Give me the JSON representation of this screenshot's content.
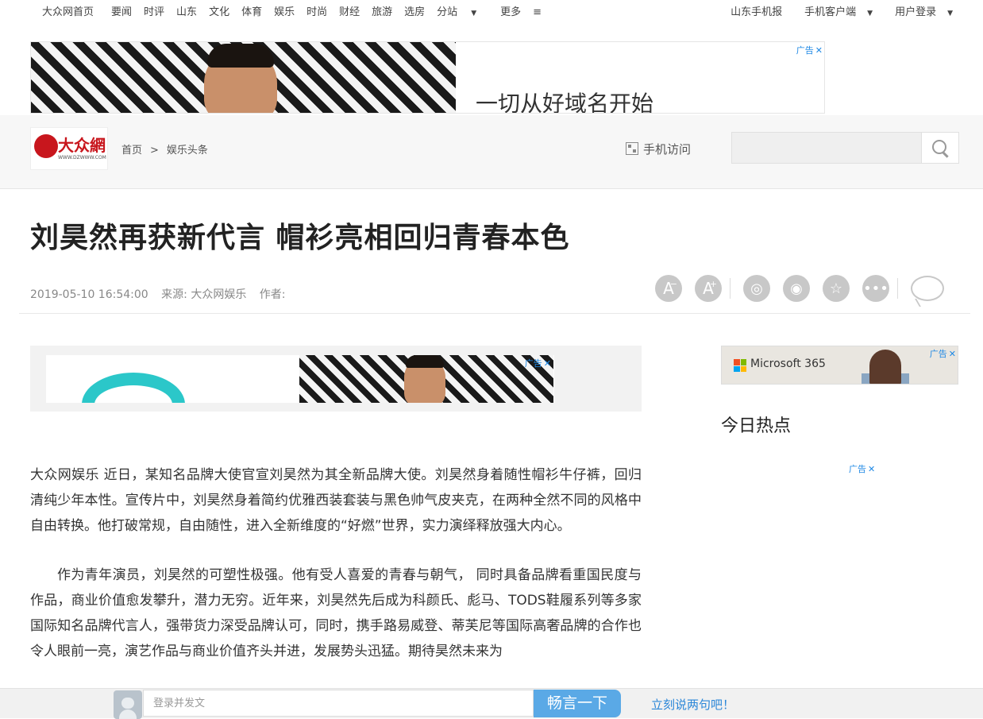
{
  "topnav": {
    "items": [
      "大众网首页",
      "要闻",
      "时评",
      "山东",
      "文化",
      "体育",
      "娱乐",
      "时尚",
      "财经",
      "旅游",
      "选房",
      "分站",
      "更多"
    ],
    "right": [
      "山东手机报",
      "手机客户端",
      "用户登录"
    ]
  },
  "top_ad": {
    "slogan": "一切从好域名开始",
    "tag": "广告"
  },
  "header": {
    "logo_text": "大众網",
    "logo_url": "WWW.DZWWW.COM",
    "breadcrumb": [
      "首页",
      "娱乐头条"
    ],
    "breadcrumb_sep": ">",
    "mobile_label": "手机访问",
    "search_placeholder": ""
  },
  "article": {
    "title": "刘昊然再获新代言 帽衫亮相回归青春本色",
    "datetime": "2019-05-10 16:54:00",
    "source": "来源: 大众网娱乐",
    "author": "作者:",
    "tools": {
      "font_smaller": "A",
      "font_bigger": "A"
    },
    "ad_tag": "广告",
    "paragraphs": [
      "大众网娱乐 近日，某知名品牌大使官宣刘昊然为其全新品牌大使。刘昊然身着随性帽衫牛仔裤，回归清纯少年本性。宣传片中，刘昊然身着简约优雅西装套装与黑色帅气皮夹克，在两种全然不同的风格中自由转换。他打破常规，自由随性，进入全新维度的“好燃”世界，实力演绎释放强大内心。",
      "作为青年演员，刘昊然的可塑性极强。他有受人喜爱的青春与朝气， 同时具备品牌看重国民度与作品，商业价值愈发攀升，潜力无穷。近年来，刘昊然先后成为科颜氏、彪马、TODS鞋履系列等多家国际知名品牌代言人，强带货力深受品牌认可，同时，携手路易威登、蒂芙尼等国际高奢品牌的合作也令人眼前一亮，演艺作品与商业价值齐头并进，发展势头迅猛。期待昊然未来为"
    ]
  },
  "sidebar": {
    "ad_label": "Microsoft 365",
    "ad_tag": "广告",
    "hot_title": "今日热点",
    "hot_ad_tag": "广告"
  },
  "comment_bar": {
    "placeholder": "登录并发文",
    "submit": "畅言一下",
    "prompt": "立刻说两句吧！"
  },
  "colors": {
    "accent_blue": "#5aa9e6",
    "link_blue": "#2a86d8",
    "logo_red": "#c8161d"
  }
}
